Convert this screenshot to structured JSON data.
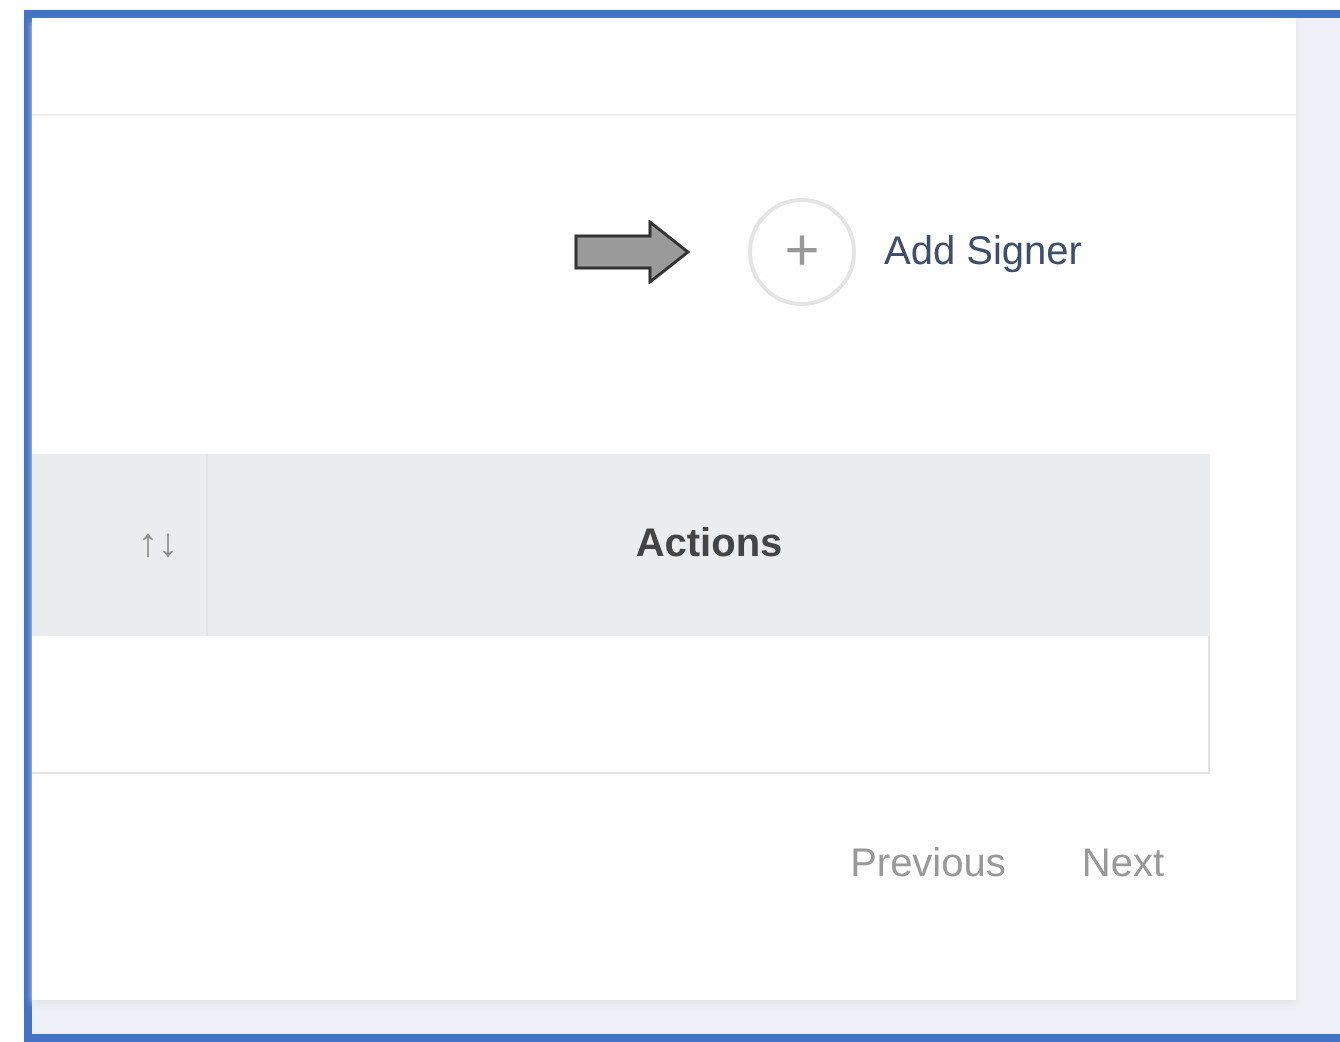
{
  "add_signer": {
    "label": "Add Signer",
    "icon": "+"
  },
  "table": {
    "columns": [
      {
        "kind": "sort",
        "label": "↑↓"
      },
      {
        "kind": "text",
        "label": "Actions"
      }
    ]
  },
  "pagination": {
    "buttons": [
      {
        "label": "Previous"
      },
      {
        "label": "Next"
      }
    ]
  }
}
